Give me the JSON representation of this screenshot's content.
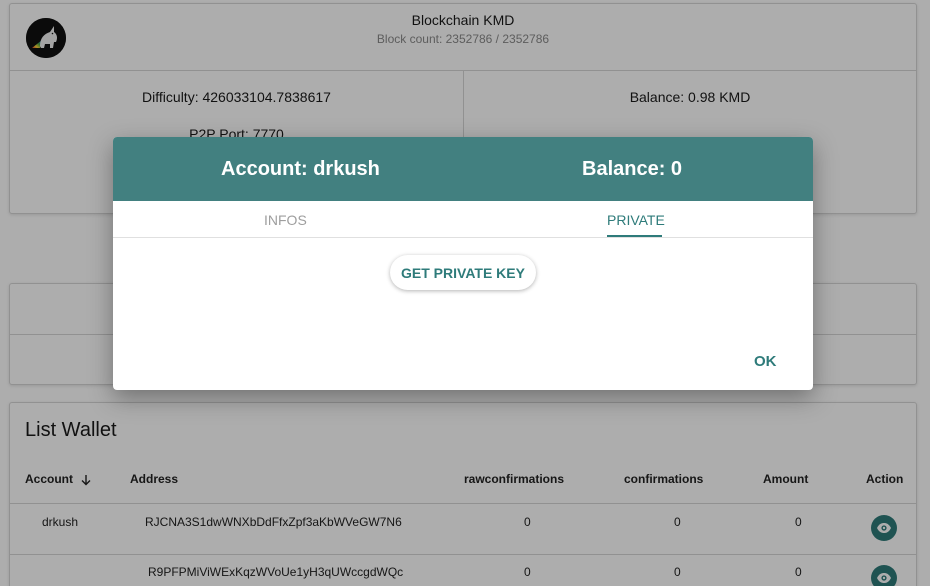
{
  "header": {
    "title": "Blockchain KMD",
    "block_count": "Block count: 2352786 / 2352786",
    "difficulty": "Difficulty: 426033104.7838617",
    "p2p_port": "P2P Port: 7770",
    "balance": "Balance: 0.98 KMD"
  },
  "list_wallet": {
    "title": "List Wallet",
    "columns": [
      "Account",
      "Address",
      "rawconfirmations",
      "confirmations",
      "Amount",
      "Action"
    ],
    "sort_icon": "arrow-down-icon",
    "rows": [
      {
        "account": "drkush",
        "address": "RJCNA3S1dwWNXbDdFfxZpf3aKbWVeGW7N6",
        "rawconfirmations": "0",
        "confirmations": "0",
        "amount": "0"
      },
      {
        "account": "",
        "address": "R9PFPMiViWExKqzWVoUe1yH3qUWccgdWQc",
        "rawconfirmations": "0",
        "confirmations": "0",
        "amount": "0"
      }
    ],
    "action_icon": "eye-icon"
  },
  "dialog": {
    "account": "Account: drkush",
    "balance": "Balance: 0",
    "tabs": [
      "Infos",
      "Private"
    ],
    "active_tab": "Private",
    "get_private_key": "Get private key",
    "ok": "OK"
  },
  "colors": {
    "accent": "#2e7b7a",
    "dialog_header": "#428080",
    "overlay": "rgba(0,0,0,0.32)"
  }
}
